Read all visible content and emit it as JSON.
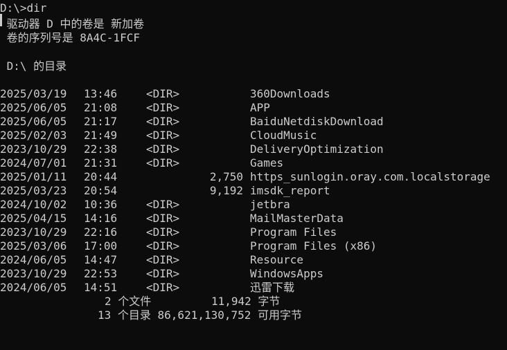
{
  "console": {
    "prompt": "D:\\>dir",
    "volume_line": " 驱动器 D 中的卷是 新加卷",
    "serial_line": " 卷的序列号是 8A4C-1FCF",
    "directory_line": " D:\\ 的目录",
    "entries": [
      {
        "date": "2025/03/19",
        "time": "13:46",
        "type": "<DIR>",
        "size": "",
        "name": "360Downloads"
      },
      {
        "date": "2025/06/05",
        "time": "21:08",
        "type": "<DIR>",
        "size": "",
        "name": "APP"
      },
      {
        "date": "2025/06/05",
        "time": "21:17",
        "type": "<DIR>",
        "size": "",
        "name": "BaiduNetdiskDownload"
      },
      {
        "date": "2025/02/03",
        "time": "21:49",
        "type": "<DIR>",
        "size": "",
        "name": "CloudMusic"
      },
      {
        "date": "2023/10/29",
        "time": "22:38",
        "type": "<DIR>",
        "size": "",
        "name": "DeliveryOptimization"
      },
      {
        "date": "2024/07/01",
        "time": "21:31",
        "type": "<DIR>",
        "size": "",
        "name": "Games"
      },
      {
        "date": "2025/01/11",
        "time": "20:44",
        "type": "",
        "size": "2,750",
        "name": "https_sunlogin.oray.com.localstorage"
      },
      {
        "date": "2025/03/23",
        "time": "20:54",
        "type": "",
        "size": "9,192",
        "name": "imsdk_report"
      },
      {
        "date": "2024/10/02",
        "time": "10:36",
        "type": "<DIR>",
        "size": "",
        "name": "jetbra"
      },
      {
        "date": "2025/04/15",
        "time": "14:16",
        "type": "<DIR>",
        "size": "",
        "name": "MailMasterData"
      },
      {
        "date": "2023/10/29",
        "time": "22:16",
        "type": "<DIR>",
        "size": "",
        "name": "Program Files"
      },
      {
        "date": "2025/03/06",
        "time": "17:00",
        "type": "<DIR>",
        "size": "",
        "name": "Program Files (x86)"
      },
      {
        "date": "2024/06/05",
        "time": "14:47",
        "type": "<DIR>",
        "size": "",
        "name": "Resource"
      },
      {
        "date": "2023/10/29",
        "time": "22:53",
        "type": "<DIR>",
        "size": "",
        "name": "WindowsApps"
      },
      {
        "date": "2024/06/05",
        "time": "14:51",
        "type": "<DIR>",
        "size": "",
        "name": "迅雷下载"
      }
    ],
    "summary_files": "2 个文件         11,942 字节",
    "summary_dirs": "13 个目录 86,621,130,752 可用字节"
  }
}
